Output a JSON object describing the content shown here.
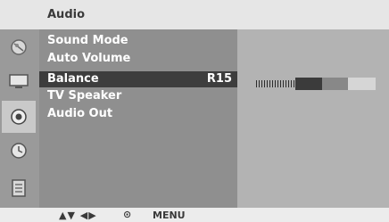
{
  "title": "Audio",
  "menu": {
    "items": [
      {
        "label": "Sound Mode",
        "value": "",
        "selected": false
      },
      {
        "label": "Auto Volume",
        "value": "",
        "selected": false
      },
      {
        "label": "Balance",
        "value": "R15",
        "selected": true
      },
      {
        "label": "TV Speaker",
        "value": "",
        "selected": false
      },
      {
        "label": "Audio Out",
        "value": "",
        "selected": false
      }
    ]
  },
  "balance": {
    "value": "R15",
    "level_fraction": 0.66
  },
  "sidebar_icons": [
    {
      "name": "picture-category-icon"
    },
    {
      "name": "screen-icon"
    },
    {
      "name": "audio-icon",
      "active": true
    },
    {
      "name": "time-icon"
    },
    {
      "name": "option-icon"
    }
  ],
  "bottom_bar": {
    "nav": "▲▼ ◀▶",
    "ok": "⊙",
    "menu": "MENU"
  },
  "colors": {
    "selected_bg": "#3d3d3d",
    "menu_bg": "#8f8f8f",
    "sub_bg": "#b3b3b3"
  }
}
